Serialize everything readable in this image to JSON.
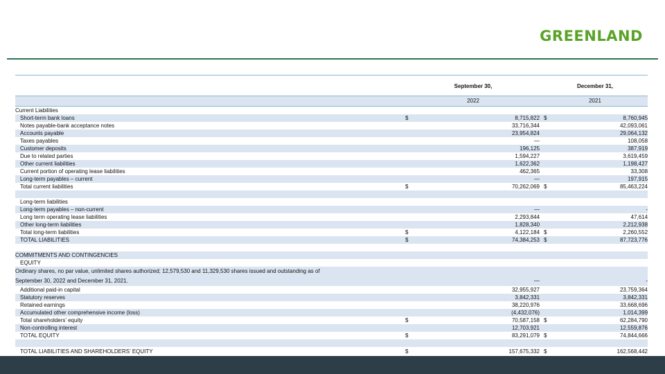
{
  "brand": {
    "logo_text": "GREENLAND"
  },
  "table": {
    "header": {
      "col1": "September 30,",
      "col2": "December 31,"
    },
    "years": {
      "col1": "2022",
      "col2": "2021"
    },
    "rows": [
      {
        "label": "Current Liabilities",
        "indent": 0,
        "cur1": "",
        "v1": "",
        "cur2": "",
        "v2": "",
        "shade": false
      },
      {
        "label": "Short-term bank loans",
        "indent": 1,
        "cur1": "$",
        "v1": "8,715,822",
        "cur2": "$",
        "v2": "8,760,945",
        "shade": true
      },
      {
        "label": "Notes payable-bank acceptance notes",
        "indent": 1,
        "cur1": "",
        "v1": "33,716,344",
        "cur2": "",
        "v2": "42,093,061",
        "shade": false
      },
      {
        "label": "Accounts payable",
        "indent": 1,
        "cur1": "",
        "v1": "23,954,824",
        "cur2": "",
        "v2": "29,064,132",
        "shade": true
      },
      {
        "label": "Taxes payables",
        "indent": 1,
        "cur1": "",
        "v1": "—",
        "cur2": "",
        "v2": "108,058",
        "shade": false
      },
      {
        "label": "Customer deposits",
        "indent": 1,
        "cur1": "",
        "v1": "196,125",
        "cur2": "",
        "v2": "387,919",
        "shade": true
      },
      {
        "label": "Due to related parties",
        "indent": 1,
        "cur1": "",
        "v1": "1,594,227",
        "cur2": "",
        "v2": "3,619,459",
        "shade": false
      },
      {
        "label": "Other current liabilities",
        "indent": 1,
        "cur1": "",
        "v1": "1,622,362",
        "cur2": "",
        "v2": "1,198,427",
        "shade": true
      },
      {
        "label": "Current portion of operating lease liabilities",
        "indent": 1,
        "cur1": "",
        "v1": "462,365",
        "cur2": "",
        "v2": "33,308",
        "shade": false
      },
      {
        "label": "Long-term payables – current",
        "indent": 1,
        "cur1": "",
        "v1": "—",
        "cur2": "",
        "v2": "197,915",
        "shade": true
      },
      {
        "label": "Total current liabilities",
        "indent": 1,
        "cur1": "$",
        "v1": "70,262,069",
        "cur2": "$",
        "v2": "85,463,224",
        "shade": false
      },
      {
        "label": "",
        "indent": 1,
        "cur1": "",
        "v1": "",
        "cur2": "",
        "v2": "",
        "shade": true
      },
      {
        "label": "Long-term liabilities",
        "indent": 1,
        "cur1": "",
        "v1": "",
        "cur2": "",
        "v2": "",
        "shade": false
      },
      {
        "label": "Long-term payables – non-current",
        "indent": 1,
        "cur1": "",
        "v1": "—",
        "cur2": "",
        "v2": "-",
        "shade": true
      },
      {
        "label": "Long term operating lease liabilities",
        "indent": 1,
        "cur1": "",
        "v1": "2,293,844",
        "cur2": "",
        "v2": "47,614",
        "shade": false
      },
      {
        "label": "Other long-term liabilities",
        "indent": 1,
        "cur1": "",
        "v1": "1,828,340",
        "cur2": "",
        "v2": "2,212,938",
        "shade": true
      },
      {
        "label": "Total long-term liabilities",
        "indent": 1,
        "cur1": "$",
        "v1": "4,122,184",
        "cur2": "$",
        "v2": "2,260,552",
        "shade": false
      },
      {
        "label": "TOTAL LIABILITIES",
        "indent": 1,
        "cur1": "$",
        "v1": "74,384,253",
        "cur2": "$",
        "v2": "87,723,776",
        "shade": true
      },
      {
        "label": "",
        "indent": 1,
        "cur1": "",
        "v1": "",
        "cur2": "",
        "v2": "",
        "shade": false
      },
      {
        "label": "COMMITMENTS AND CONTINGENCIES",
        "indent": 0,
        "cur1": "",
        "v1": "",
        "cur2": "",
        "v2": "",
        "shade": true
      },
      {
        "label": "EQUITY",
        "indent": 1,
        "cur1": "",
        "v1": "",
        "cur2": "",
        "v2": "",
        "shade": false
      },
      {
        "label": "Ordinary shares, no par value, unlimited shares authorized; 12,579,530 and 11,329,530 shares issued and outstanding as of",
        "indent": 0,
        "cur1": "",
        "v1": "",
        "cur2": "",
        "v2": "",
        "shade": true,
        "tall": true
      },
      {
        "label": "September 30, 2022 and December 31, 2021.",
        "indent": 0,
        "cur1": "",
        "v1": "—",
        "cur2": "",
        "v2": "-",
        "shade": true,
        "tall": true
      },
      {
        "label": "Additional paid-in capital",
        "indent": 1,
        "cur1": "",
        "v1": "32,955,927",
        "cur2": "",
        "v2": "23,759,364",
        "shade": false
      },
      {
        "label": "Statutory reserves",
        "indent": 1,
        "cur1": "",
        "v1": "3,842,331",
        "cur2": "",
        "v2": "3,842,331",
        "shade": true
      },
      {
        "label": "Retained earnings",
        "indent": 1,
        "cur1": "",
        "v1": "38,220,976",
        "cur2": "",
        "v2": "33,668,696",
        "shade": false
      },
      {
        "label": "Accumulated other comprehensive income (loss)",
        "indent": 1,
        "cur1": "",
        "v1": "(4,432,076)",
        "cur2": "",
        "v2": "1,014,399",
        "shade": true
      },
      {
        "label": "Total shareholders’ equity",
        "indent": 1,
        "cur1": "$",
        "v1": "70,587,158",
        "cur2": "$",
        "v2": "62,284,790",
        "shade": false
      },
      {
        "label": "Non-controlling interest",
        "indent": 1,
        "cur1": "",
        "v1": "12,703,921",
        "cur2": "",
        "v2": "12,559,876",
        "shade": true
      },
      {
        "label": "TOTAL EQUITY",
        "indent": 1,
        "cur1": "$",
        "v1": "83,291,079",
        "cur2": "$",
        "v2": "74,844,666",
        "shade": false
      },
      {
        "label": "",
        "indent": 1,
        "cur1": "",
        "v1": "",
        "cur2": "",
        "v2": "",
        "shade": true
      },
      {
        "label": "TOTAL LIABILITIES AND SHAREHOLDERS’ EQUITY",
        "indent": 1,
        "cur1": "$",
        "v1": "157,675,332",
        "cur2": "$",
        "v2": "162,568,442",
        "shade": false,
        "tall": true,
        "last": true
      }
    ]
  }
}
